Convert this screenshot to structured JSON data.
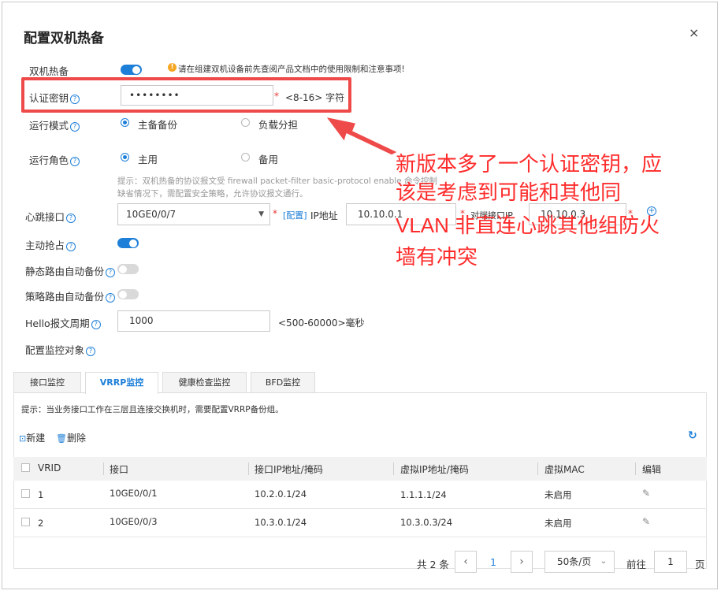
{
  "dialog": {
    "title": "配置双机热备",
    "close": "×"
  },
  "form": {
    "ha_label": "双机热备",
    "ha_warning": "请在组建双机设备前先查阅产品文档中的使用限制和注意事项!",
    "auth_key_label": "认证密钥",
    "auth_key_value": "••••••••",
    "auth_key_range": "<8-16> 字符",
    "run_mode_label": "运行模式",
    "run_mode_options": [
      "主备备份",
      "负载分担"
    ],
    "run_role_label": "运行角色",
    "run_role_options": [
      "主用",
      "备用"
    ],
    "hint_line1": "提示：双机热备的协议报文受 firewall packet-filter basic-protocol enable 命令控制",
    "hint_line2": "缺省情况下，需配置安全策略，允许协议报文通行。",
    "heartbeat_label": "心跳接口",
    "heartbeat_value": "10GE0/0/7",
    "heartbeat_config_link": "[配置]",
    "ip_label": "IP地址",
    "ip_value": "10.10.0.1",
    "peer_ip_label": "对端接口IP",
    "peer_ip_value": "10.10.0.3",
    "preempt_label": "主动抢占",
    "static_route_label": "静态路由自动备份",
    "policy_route_label": "策略路由自动备份",
    "hello_label": "Hello报文周期",
    "hello_value": "1000",
    "hello_range": "<500-60000>毫秒",
    "monitor_label": "配置监控对象"
  },
  "tabs": [
    "接口监控",
    "VRRP监控",
    "健康检查监控",
    "BFD监控"
  ],
  "tab_hint": "提示：当业务接口工作在三层且连接交换机时，需要配置VRRP备份组。",
  "toolbar": {
    "new_label": "新建",
    "delete_label": "删除"
  },
  "table": {
    "headers": [
      "VRID",
      "接口",
      "接口IP地址/掩码",
      "虚拟IP地址/掩码",
      "虚拟MAC",
      "编辑"
    ],
    "rows": [
      {
        "vrid": "1",
        "iface": "10GE0/0/1",
        "ip": "10.2.0.1/24",
        "vip": "1.1.1.1/24",
        "mac": "未启用"
      },
      {
        "vrid": "2",
        "iface": "10GE0/0/3",
        "ip": "10.3.0.1/24",
        "vip": "10.3.0.3/24",
        "mac": "未启用"
      }
    ]
  },
  "pagination": {
    "total": "共 2 条",
    "prev": "‹",
    "page": "1",
    "next": "›",
    "page_size": "50条/页",
    "goto_label": "前往",
    "goto_value": "1",
    "page_unit": "页"
  },
  "annotation": {
    "lines": [
      "新版本多了一个认证密钥，应",
      "该是考虑到可能和其他同",
      "VLAN 非直连心跳其他组防火",
      "墙有冲突"
    ]
  },
  "colors": {
    "accent": "#1e7fd8",
    "annotation": "#ff2b2b",
    "warning": "#f5a623"
  }
}
